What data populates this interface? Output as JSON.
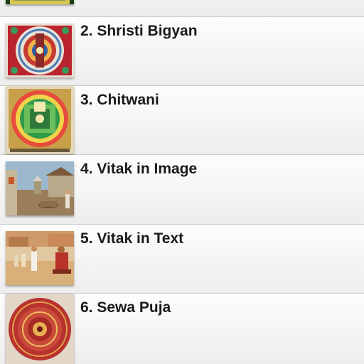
{
  "list": {
    "items": [
      {
        "label": ""
      },
      {
        "label": "2. Shristi Bigyan",
        "icon": "mandala-thumbnail"
      },
      {
        "label": "3. Chitwani",
        "icon": "green-mandala-thumbnail"
      },
      {
        "label": "4. Vitak in Image",
        "icon": "village-scene-thumbnail"
      },
      {
        "label": "5. Vitak in Text",
        "icon": "courtyard-scene-thumbnail"
      },
      {
        "label": "6. Sewa Puja",
        "icon": "red-circular-mandala-thumbnail"
      }
    ]
  },
  "colors": {
    "row_background": "#f6f6f6",
    "divider": "#c9c9c9",
    "text": "#1a1a1a"
  }
}
